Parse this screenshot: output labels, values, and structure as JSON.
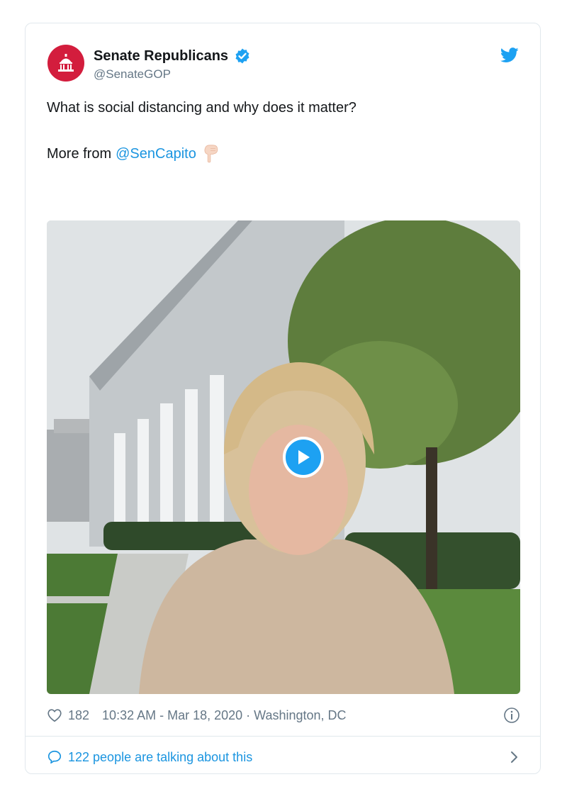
{
  "account": {
    "name": "Senate Republicans",
    "handle": "@SenateGOP"
  },
  "tweet": {
    "line1": "What is social distancing and why does it matter?",
    "more_from": "More from",
    "mention": "@SenCapito",
    "pointing_emoji": "pointing-down-hand-icon"
  },
  "footer": {
    "likes": "182",
    "timestamp": "10:32 AM - Mar 18, 2020 · Washington, DC"
  },
  "conversation": {
    "label": "122 people are talking about this"
  },
  "colors": {
    "brand_red": "#d31d3d",
    "twitter_blue": "#1da1f2",
    "link_blue": "#1b95e0",
    "muted": "#657786"
  }
}
